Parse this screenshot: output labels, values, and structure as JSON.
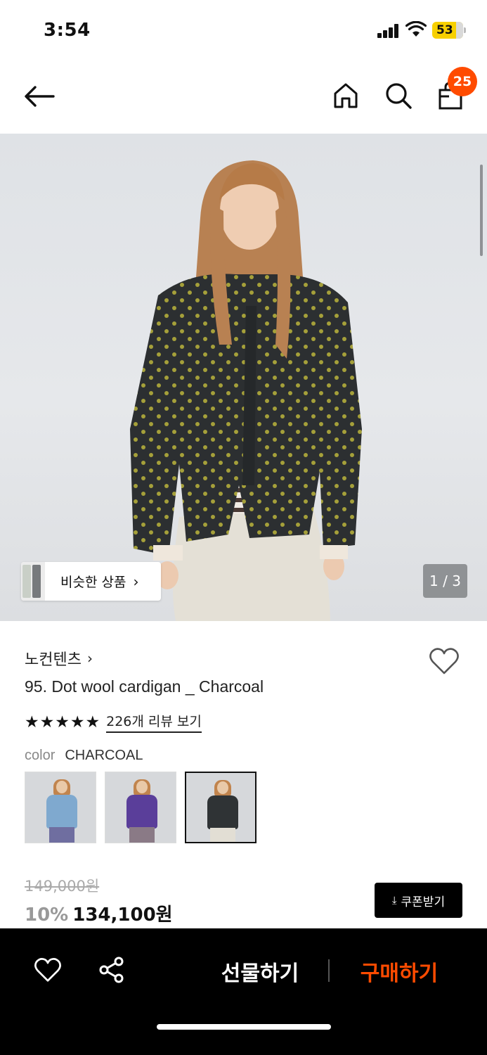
{
  "status_bar": {
    "time": "3:54",
    "battery": "53"
  },
  "header": {
    "cart_count": "25",
    "icons": [
      "back-arrow-icon",
      "home-icon",
      "search-icon",
      "shopping-bag-icon"
    ]
  },
  "gallery": {
    "similar_label": "비슷한 상품",
    "counter": "1 / 3",
    "current_index": 1,
    "total": 3
  },
  "product": {
    "brand": "노컨텐츠",
    "title": "95. Dot wool cardigan _ Charcoal",
    "rating": 5,
    "review_link": "226개 리뷰 보기",
    "color_label": "color",
    "color_value": "CHARCOAL",
    "swatches": [
      {
        "color": "light-blue",
        "selected": false
      },
      {
        "color": "purple",
        "selected": false
      },
      {
        "color": "charcoal",
        "selected": true
      }
    ],
    "original_price": "149,000원",
    "discount": "10%",
    "price": "134,100원",
    "coupon_label": "쿠폰받기"
  },
  "bottom_bar": {
    "gift_label": "선물하기",
    "buy_label": "구매하기"
  },
  "colors": {
    "accent": "#ff4b00",
    "bottom_bar": "#000000",
    "battery": "#f7d000"
  }
}
